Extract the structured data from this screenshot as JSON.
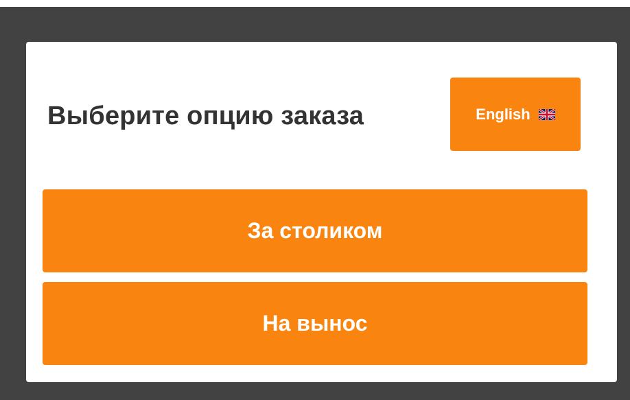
{
  "dialog": {
    "title": "Выберите опцию заказа",
    "language_button": {
      "label": "English",
      "icon": "uk-flag-icon"
    },
    "options": [
      {
        "label": "За столиком"
      },
      {
        "label": "На вынос"
      }
    ]
  },
  "colors": {
    "accent": "#f98510",
    "backdrop": "#424242",
    "title_text": "#333333",
    "button_text": "#ffffff",
    "modal_bg": "#ffffff"
  }
}
